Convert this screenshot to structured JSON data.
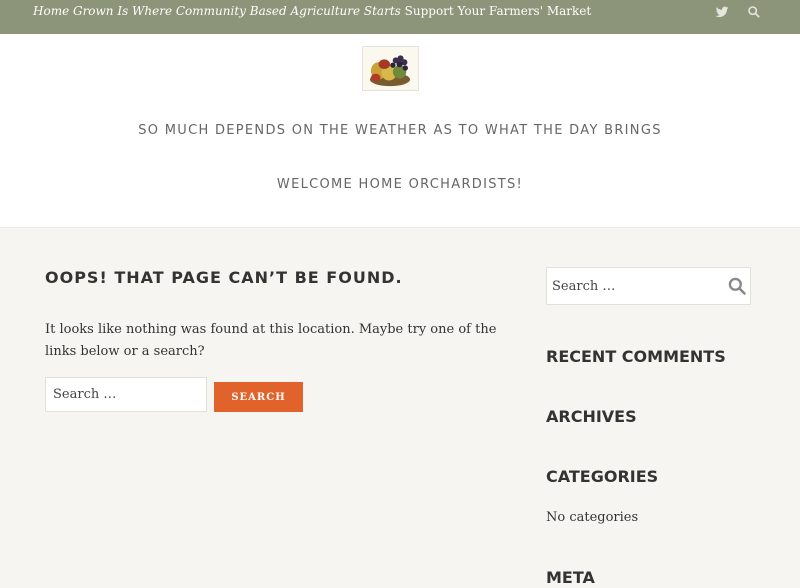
{
  "topbar": {
    "tagline_italic": "Home Grown Is Where Community Based Agriculture Starts",
    "tagline_plain": "Support Your Farmers' Market",
    "icons": [
      "twitter-icon",
      "search-icon"
    ]
  },
  "header": {
    "line1": "SO MUCH DEPENDS ON THE WEATHER AS TO WHAT THE DAY BRINGS",
    "line2": "WELCOME HOME ORCHARDISTS!"
  },
  "main": {
    "title": "OOPS! THAT PAGE CAN’T BE FOUND.",
    "description": "It looks like nothing was found at this location. Maybe try one of the links below or a search?",
    "search_placeholder": "Search …",
    "search_button": "Search"
  },
  "sidebar": {
    "search_placeholder": "Search …",
    "recent_comments": "RECENT COMMENTS",
    "archives": "ARCHIVES",
    "categories": "CATEGORIES",
    "no_categories": "No categories",
    "meta": "META"
  },
  "colors": {
    "topbar": "#8c9479",
    "accent": "#e2622b",
    "background": "#f6f5f1"
  }
}
